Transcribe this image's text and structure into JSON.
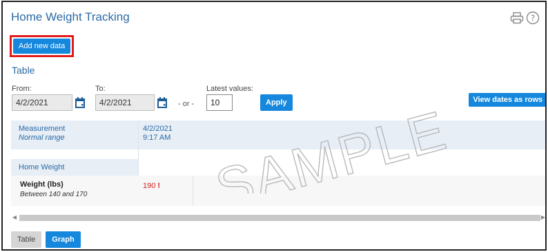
{
  "page": {
    "title": "Home Weight Tracking",
    "print_icon": "printer-icon",
    "help_icon": "help-circle-icon"
  },
  "actions": {
    "add_new_data": "Add new data"
  },
  "section": {
    "title": "Table"
  },
  "filters": {
    "from_label": "From:",
    "from_value": "4/2/2021",
    "to_label": "To:",
    "to_value": "4/2/2021",
    "or_text": "- or -",
    "latest_label": "Latest values:",
    "latest_value": "10",
    "apply_label": "Apply",
    "view_rows_label": "View dates as rows",
    "calendar_icon": "calendar-icon"
  },
  "table": {
    "header": {
      "measurement_label": "Measurement",
      "normal_range_label": "Normal range",
      "date": "4/2/2021",
      "time": "9:17 AM"
    },
    "group": "Home Weight",
    "rows": [
      {
        "name": "Weight (lbs)",
        "range": "Between 140 and 170",
        "value": "190",
        "flag": "!"
      }
    ]
  },
  "watermark": "SAMPLE",
  "tabs": {
    "table_label": "Table",
    "graph_label": "Graph"
  },
  "colors": {
    "accent": "#1588dd",
    "title": "#2a6aa5",
    "highlight_border": "#e31b1b",
    "abnormal": "#d0201a"
  }
}
